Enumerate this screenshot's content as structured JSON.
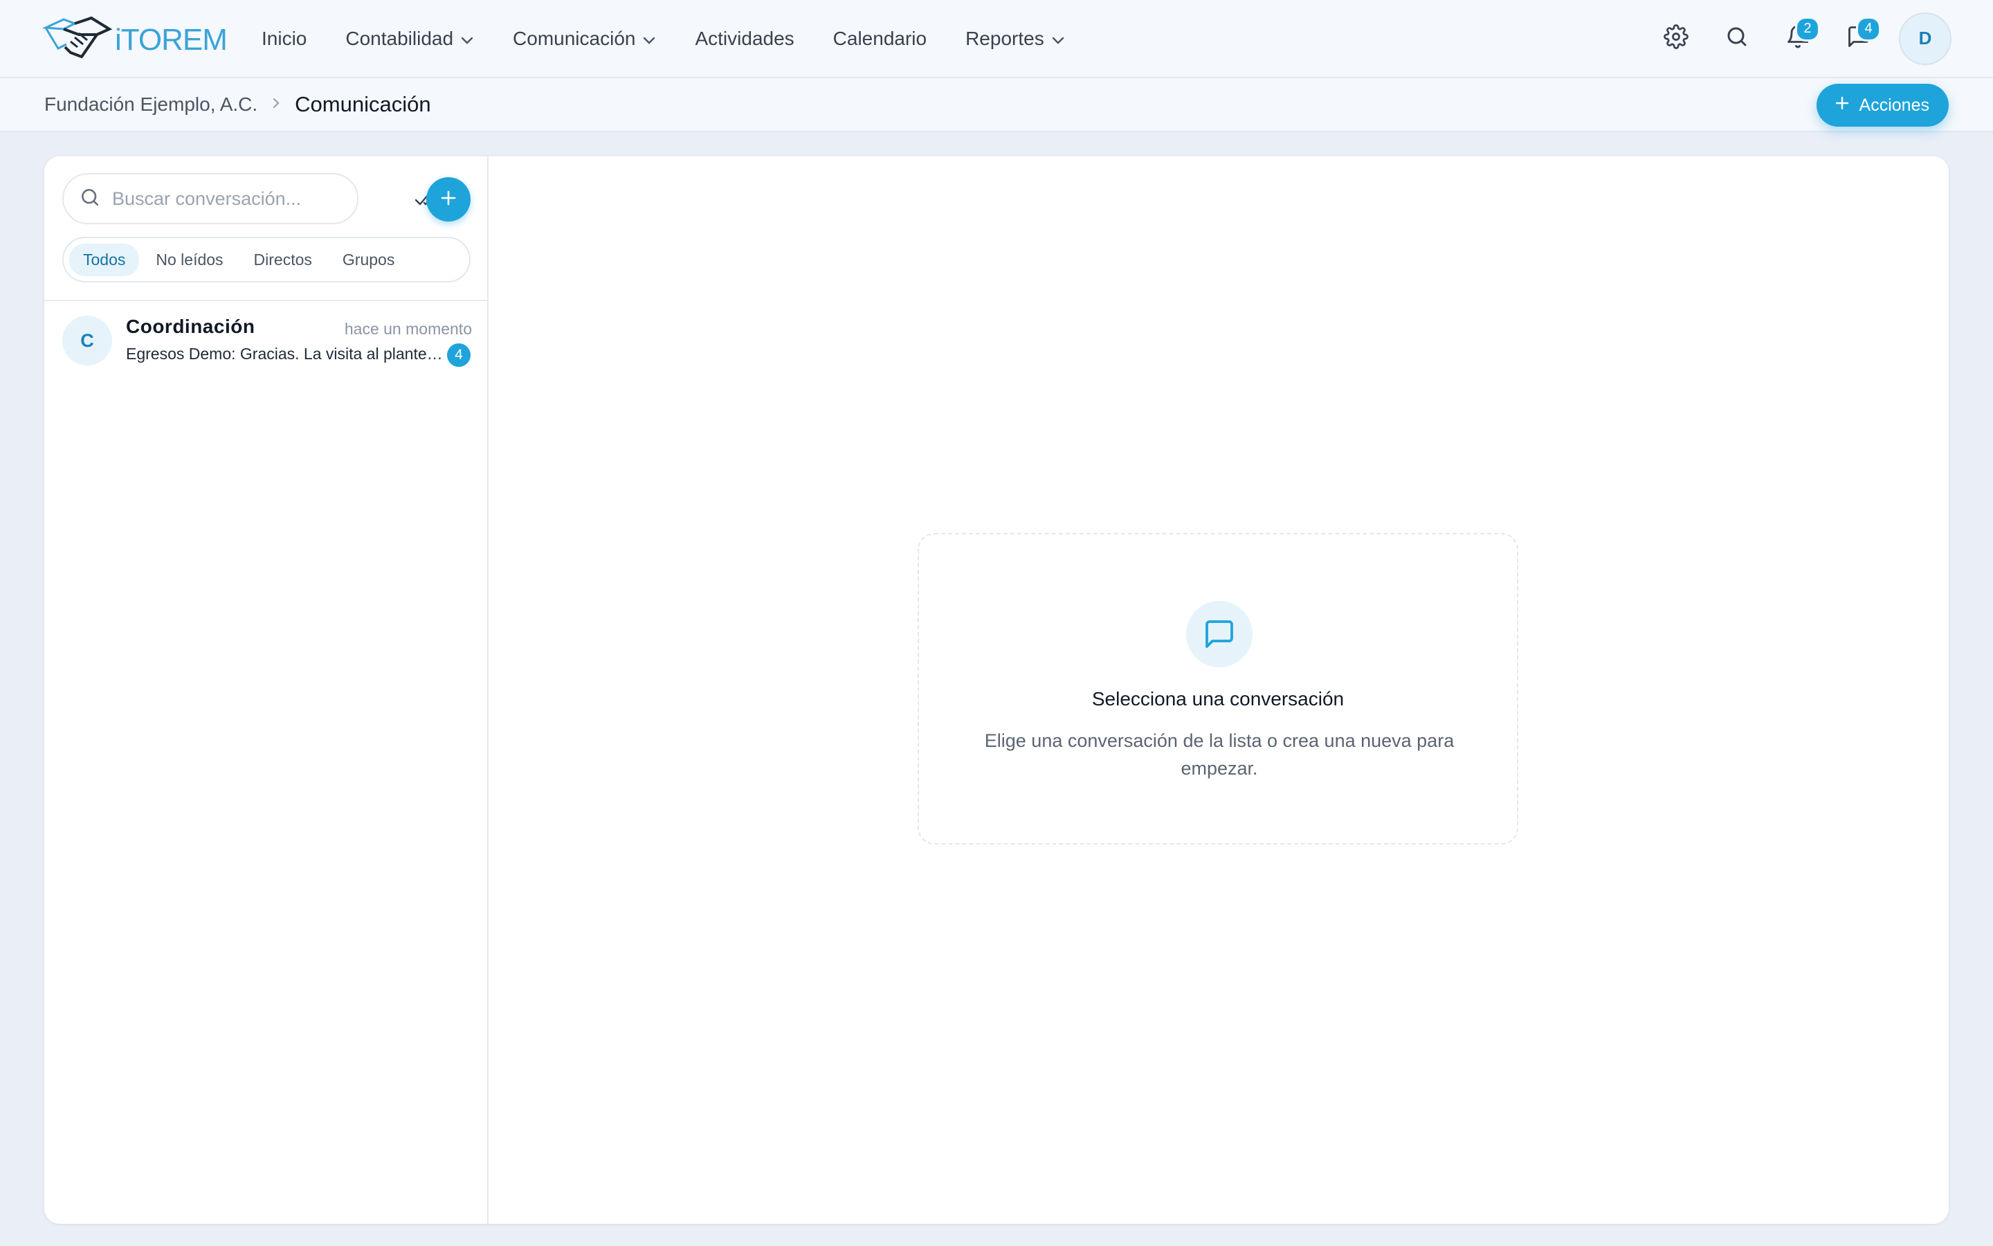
{
  "app": {
    "brand": "iTOREM"
  },
  "nav": {
    "items": [
      {
        "label": "Inicio",
        "dropdown": false
      },
      {
        "label": "Contabilidad",
        "dropdown": true
      },
      {
        "label": "Comunicación",
        "dropdown": true
      },
      {
        "label": "Actividades",
        "dropdown": false
      },
      {
        "label": "Calendario",
        "dropdown": false
      },
      {
        "label": "Reportes",
        "dropdown": true
      }
    ]
  },
  "header": {
    "notifications_count": "2",
    "messages_count": "4",
    "user_initial": "D",
    "icons": [
      "gear-icon",
      "search-icon",
      "bell-icon",
      "chat-icon"
    ]
  },
  "breadcrumb": {
    "root": "Fundación Ejemplo, A.C.",
    "current": "Comunicación"
  },
  "actions": {
    "label": "Acciones"
  },
  "conversations": {
    "search_placeholder": "Buscar conversación...",
    "filters": [
      "Todos",
      "No leídos",
      "Directos",
      "Grupos"
    ],
    "active_filter": "Todos",
    "items": [
      {
        "initial": "C",
        "name": "Coordinación",
        "time": "hace un momento",
        "preview": "Egresos Demo: Gracias. La visita al plantel fue muy productiva",
        "unread": "4"
      }
    ]
  },
  "empty_state": {
    "title": "Selecciona una conversación",
    "subtitle": "Elige una conversación de la lista o crea una nueva para empezar."
  },
  "colors": {
    "accent": "#1ea4db",
    "brand": "#3aa4d8",
    "page_bg": "#e9eef7"
  }
}
